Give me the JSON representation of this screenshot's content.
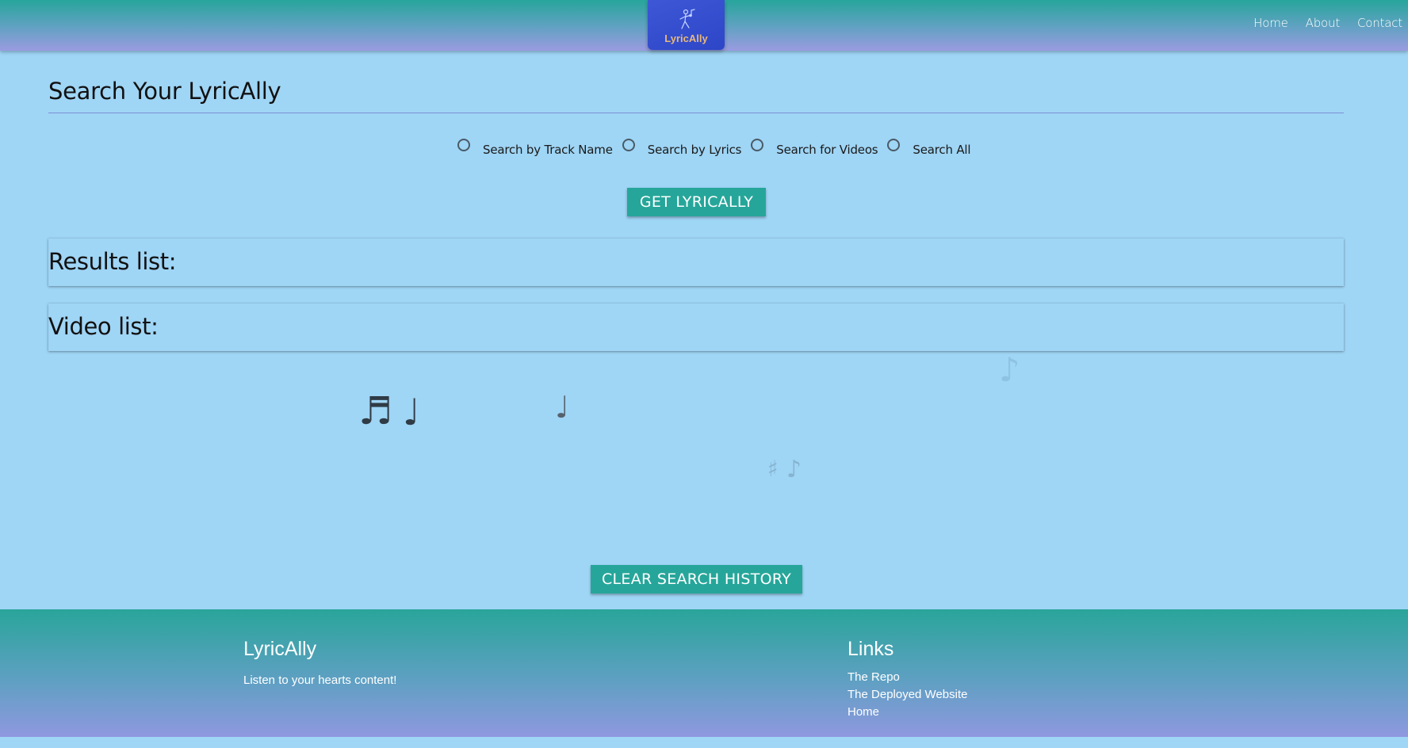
{
  "header": {
    "logo_text": "LyricAlly",
    "nav": [
      "Home",
      "About",
      "Contact"
    ]
  },
  "main": {
    "title": "Search Your LyricAlly",
    "search_options": [
      {
        "label": "Search by Track Name",
        "selected": false
      },
      {
        "label": "Search by Lyrics",
        "selected": false
      },
      {
        "label": "Search for Videos",
        "selected": false
      },
      {
        "label": "Search All",
        "selected": false
      }
    ],
    "get_button": "GET LYRICALLY",
    "results_heading": "Results list:",
    "video_heading": "Video list:",
    "clear_button": "CLEAR SEARCH HISTORY"
  },
  "decorations": {
    "notes": [
      "♬",
      "♩",
      "♩",
      "♯",
      "♪",
      "♪"
    ]
  },
  "footer": {
    "title": "LyricAlly",
    "tagline": "Listen to your hearts content!",
    "links_title": "Links",
    "links": [
      "The Repo",
      "The Deployed Website",
      "Home"
    ]
  },
  "colors": {
    "page_bg": "#9fd5f5",
    "accent": "#26a69a",
    "logo_bg": "#3d57d6"
  }
}
